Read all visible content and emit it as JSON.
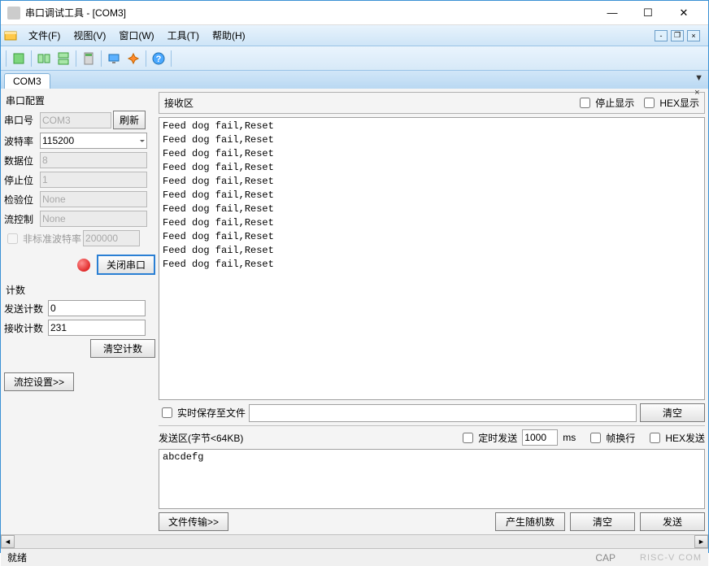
{
  "window": {
    "title": "串口调试工具 - [COM3]",
    "min": "—",
    "max": "☐",
    "close": "✕"
  },
  "menu": {
    "file": "文件(F)",
    "view": "视图(V)",
    "window": "窗口(W)",
    "tools": "工具(T)",
    "help": "帮助(H)"
  },
  "mdi": {
    "min": "-",
    "restore": "❐",
    "close": "×"
  },
  "tab": {
    "label": "COM3",
    "pin": "▼",
    "close": "×"
  },
  "config": {
    "title": "串口配置",
    "port_label": "串口号",
    "port_value": "COM3",
    "refresh": "刷新",
    "baud_label": "波特率",
    "baud_value": "115200",
    "databits_label": "数据位",
    "databits_value": "8",
    "stopbits_label": "停止位",
    "stopbits_value": "1",
    "parity_label": "检验位",
    "parity_value": "None",
    "flow_label": "流控制",
    "flow_value": "None",
    "nonstd_label": "非标准波特率",
    "nonstd_value": "200000",
    "close_port": "关闭串口"
  },
  "counts": {
    "title": "计数",
    "send_label": "发送计数",
    "send_value": "0",
    "recv_label": "接收计数",
    "recv_value": "231",
    "clear": "清空计数"
  },
  "flowctl_btn": "流控设置>>",
  "rx": {
    "title": "接收区",
    "stop_display": "停止显示",
    "hex_display": "HEX显示",
    "lines": [
      "Feed dog fail,Reset",
      "Feed dog fail,Reset",
      "Feed dog fail,Reset",
      "Feed dog fail,Reset",
      "Feed dog fail,Reset",
      "Feed dog fail,Reset",
      "Feed dog fail,Reset",
      "Feed dog fail,Reset",
      "Feed dog fail,Reset",
      "Feed dog fail,Reset",
      "Feed dog fail,Reset"
    ]
  },
  "save_realtime": "实时保存至文件",
  "clear_rx": "清空",
  "tx": {
    "title": "发送区(字节<64KB)",
    "timed_send": "定时发送",
    "interval": "1000",
    "ms": "ms",
    "wrap": "帧换行",
    "hex_send": "HEX发送",
    "content": "abcdefg",
    "file_transfer": "文件传输>>",
    "random": "产生随机数",
    "clear": "清空",
    "send": "发送"
  },
  "status": {
    "ready": "就绪",
    "caps": "CAP",
    "watermark": "RISC-V COM"
  }
}
